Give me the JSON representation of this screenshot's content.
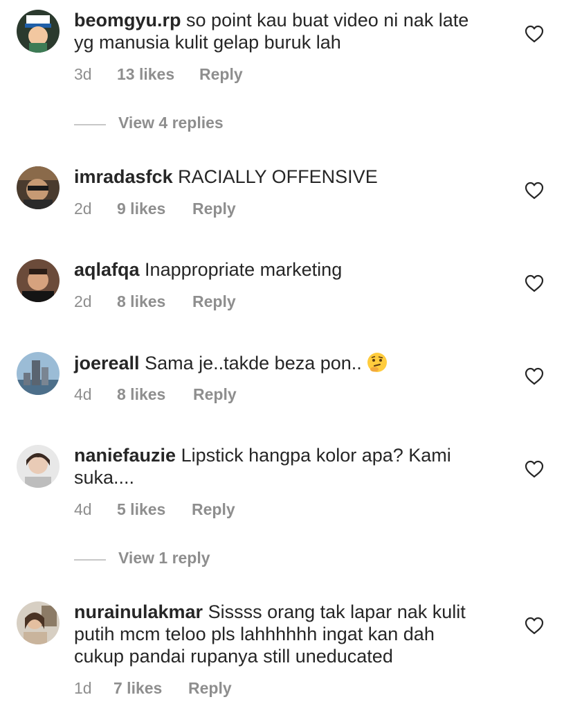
{
  "comments": [
    {
      "username": "beomgyu.rp",
      "text": "so point kau buat video ni nak late yg manusia kulit gelap buruk lah",
      "time": "3d",
      "likes": "13 likes",
      "reply": "Reply"
    },
    {
      "username": "imradasfck",
      "text": "RACIALLY OFFENSIVE",
      "time": "2d",
      "likes": "9 likes",
      "reply": "Reply"
    },
    {
      "username": "aqlafqa",
      "text": "Inappropriate marketing",
      "time": "2d",
      "likes": "8 likes",
      "reply": "Reply"
    },
    {
      "username": "joereall",
      "text": "Sama je..takde beza pon..",
      "emoji": "thinking-face",
      "time": "4d",
      "likes": "8 likes",
      "reply": "Reply"
    },
    {
      "username": "naniefauzie",
      "text": "Lipstick hangpa kolor apa? Kami suka....",
      "time": "4d",
      "likes": "5 likes",
      "reply": "Reply"
    },
    {
      "username": "nurainulakmar",
      "text": "Sissss orang tak lapar nak kulit putih mcm teloo pls lahhhhhh ingat kan dah cukup pandai rupanya still uneducated",
      "time": "1d",
      "likes": "7 likes",
      "reply": "Reply"
    }
  ],
  "view_replies": [
    {
      "label": "View 4 replies"
    },
    {
      "label": "View 1 reply"
    }
  ],
  "colors": {
    "text": "#262626",
    "muted": "#8e8e8e",
    "divider": "#c7c7c7"
  }
}
